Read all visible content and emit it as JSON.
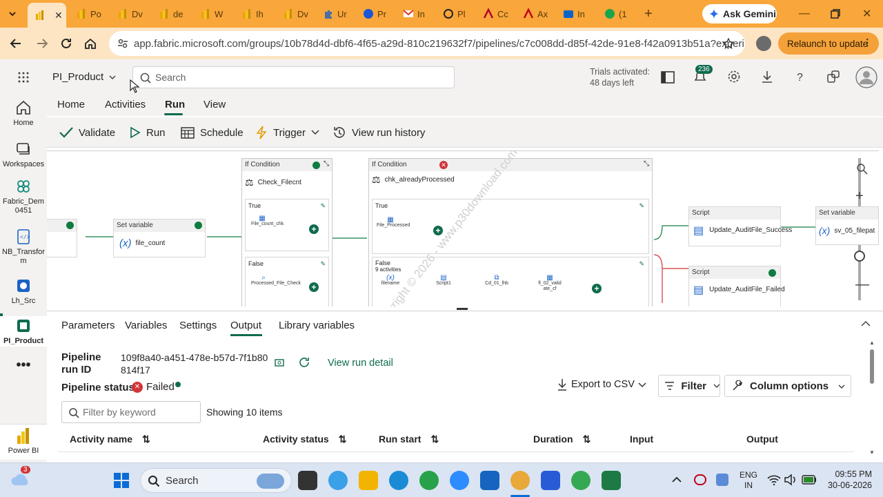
{
  "browser": {
    "tabs": [
      {
        "label": "",
        "icon": "powerbi-icon"
      },
      {
        "label": "Po",
        "icon": "powerbi-icon"
      },
      {
        "label": "Dv",
        "icon": "powerbi-icon"
      },
      {
        "label": "de",
        "icon": "powerbi-icon"
      },
      {
        "label": "W",
        "icon": "powerbi-icon"
      },
      {
        "label": "Ih",
        "icon": "powerbi-icon"
      },
      {
        "label": "Dv",
        "icon": "powerbi-icon"
      },
      {
        "label": "Ur",
        "icon": "puzzle-icon"
      },
      {
        "label": "Pr",
        "icon": "globe-icon"
      },
      {
        "label": "In",
        "icon": "gmail-icon"
      },
      {
        "label": "Pl",
        "icon": "chatgpt-icon"
      },
      {
        "label": "Cc",
        "icon": "coursera-icon"
      },
      {
        "label": "Ax",
        "icon": "airtel-icon"
      },
      {
        "label": "In",
        "icon": "outlook-icon"
      },
      {
        "label": "(1",
        "icon": "whatsapp-icon"
      }
    ],
    "gemini_label": "Ask Gemini",
    "url": "app.fabric.microsoft.com/groups/10b78d4d-dbf6-4f65-a29d-810c219632f7/pipelines/c7c008dd-d85f-42de-91e8-f42a0913b51a?experi...",
    "relaunch_label": "Relaunch to update",
    "colors": {
      "tabstrip": "#f9a63a",
      "toolbar": "#fde5c4"
    }
  },
  "header": {
    "workspace": "PI_Product",
    "search_placeholder": "Search",
    "trial_line1": "Trials activated:",
    "trial_line2": "48 days left",
    "notif_count": "236"
  },
  "rail": [
    {
      "label": "Home",
      "icon": "home-icon"
    },
    {
      "label": "Workspaces",
      "icon": "workspaces-icon"
    },
    {
      "label": "Fabric_Dem 0451",
      "icon": "fabric-icon"
    },
    {
      "label": "NB_Transfor m",
      "icon": "notebook-icon"
    },
    {
      "label": "Lh_Src",
      "icon": "lakehouse-icon"
    },
    {
      "label": "PI_Product",
      "icon": "pipeline-icon"
    },
    {
      "label": "Power BI",
      "icon": "powerbi-icon"
    }
  ],
  "ribbon": {
    "tabs": [
      "Home",
      "Activities",
      "Run",
      "View"
    ],
    "active_tab": "Run",
    "buttons": {
      "validate": "Validate",
      "run": "Run",
      "schedule": "Schedule",
      "trigger": "Trigger",
      "history": "View run history"
    }
  },
  "canvas": {
    "set_variable_1": {
      "type": "Set variable",
      "name": "file_count"
    },
    "if1": {
      "type": "If Condition",
      "name": "Check_Filecnt",
      "true_label": "True",
      "false_label": "False",
      "true_activity": "File_count_chk",
      "false_activity": "Processed_File_Check"
    },
    "if2": {
      "type": "If Condition",
      "name": "chk_alreadyProcessed",
      "true_label": "True",
      "false_label": "False",
      "false_count": "9 activities",
      "true_activity": "File_Processed",
      "false_activities": [
        "filename",
        "Script1",
        "Cd_01_lhb",
        "fl_02_valid ate_cf"
      ]
    },
    "script_success": {
      "type": "Script",
      "name": "Update_AuditFile_Success"
    },
    "script_failed": {
      "type": "Script",
      "name": "Update_AuditFile_Failed"
    },
    "set_variable_2": {
      "type": "Set variable",
      "name": "sv_05_filepat"
    },
    "watermark": "Copyright © 2026 - www.p30download.com"
  },
  "panel": {
    "tabs": [
      "Parameters",
      "Variables",
      "Settings",
      "Output",
      "Library variables"
    ],
    "active_tab": "Output",
    "run_id_label": "Pipeline run ID",
    "run_id": "109f8a40-a451-478e-b57d-7f1b80814f17",
    "view_run_detail": "View run detail",
    "status_label": "Pipeline status",
    "status": "Failed",
    "export": "Export to CSV",
    "filter": "Filter",
    "column_options": "Column options",
    "filter_placeholder": "Filter by keyword",
    "showing": "Showing 10 items",
    "columns": [
      "Activity name",
      "Activity status",
      "Run start",
      "Duration",
      "Input",
      "Output"
    ]
  },
  "taskbar": {
    "search": "Search",
    "weather_badge": "3",
    "lang1": "ENG",
    "lang2": "IN",
    "time": "09:55 PM",
    "date": "30-06-2026"
  }
}
